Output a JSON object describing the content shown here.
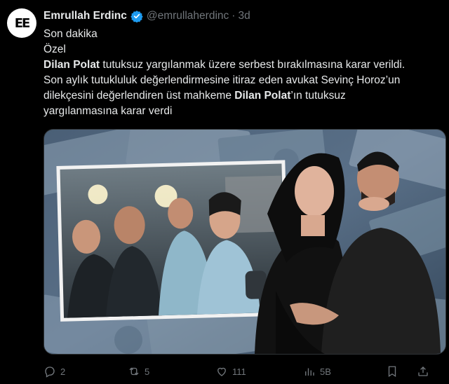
{
  "tweet": {
    "author_name": "Emrullah Erdinc",
    "handle": "@emrullaherdinc",
    "separator": "·",
    "time": "3d",
    "avatar_text": "EE",
    "lines": [
      {
        "parts": [
          {
            "text": "Son dakika",
            "bold": false
          }
        ]
      },
      {
        "parts": [
          {
            "text": "Özel",
            "bold": false
          }
        ]
      },
      {
        "parts": [
          {
            "text": "Dilan Polat",
            "bold": true
          },
          {
            "text": " tutuksuz yargılanmak üzere serbest bırakılmasına karar verildi.",
            "bold": false
          }
        ]
      },
      {
        "parts": [
          {
            "text": "Son aylık tutukluluk değerlendirmesine itiraz eden avukat Sevinç Horoz’un",
            "bold": false
          }
        ]
      },
      {
        "parts": [
          {
            "text": "dilekçesini değerlendiren üst mahkeme ",
            "bold": false
          },
          {
            "text": "Dilan Polat",
            "bold": true
          },
          {
            "text": "’ın tutuksuz",
            "bold": false
          }
        ]
      },
      {
        "parts": [
          {
            "text": "yargılanmasına karar verdi",
            "bold": false
          }
        ]
      }
    ]
  },
  "actions": {
    "replies": "2",
    "reposts": "5",
    "likes": "111",
    "views": "5B"
  },
  "colors": {
    "background": "#000000",
    "text": "#e7e9ea",
    "muted": "#71767b",
    "verified": "#1d9bf0"
  }
}
